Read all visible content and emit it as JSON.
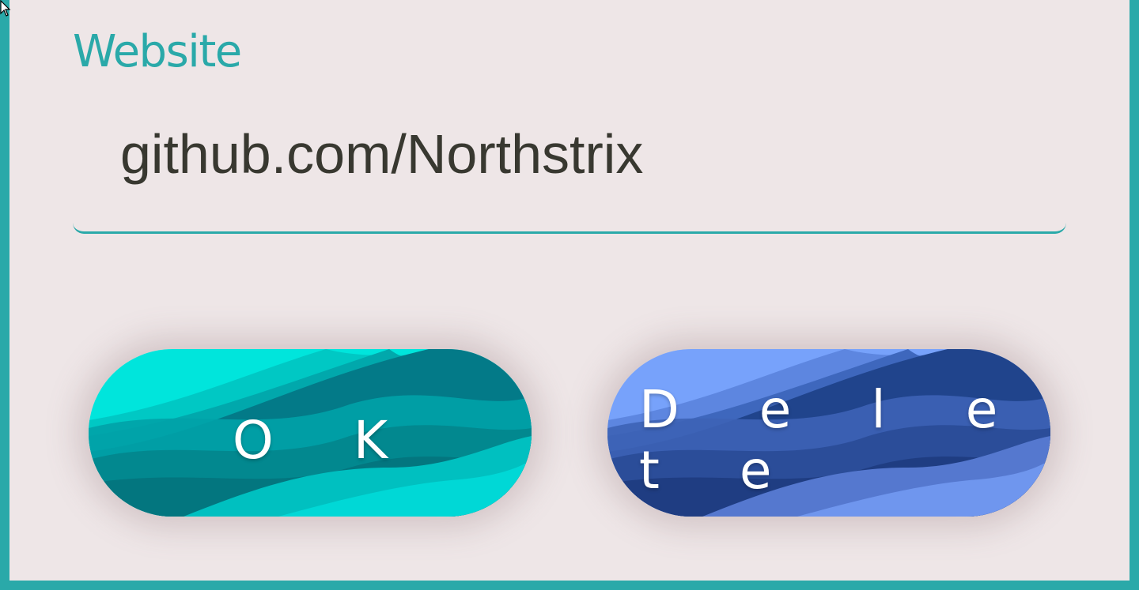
{
  "form": {
    "website_label": "Website",
    "website_value": "github.com/Northstrix"
  },
  "buttons": {
    "ok_label": "O K",
    "delete_label": "D e l e t e"
  },
  "colors": {
    "accent": "#2aa9a9",
    "background": "#eee6e7",
    "text": "#383830",
    "ok_primary": "#00e5dc",
    "delete_primary": "#77a2fb"
  },
  "icons": {
    "cursor": "mouse-pointer-icon"
  }
}
